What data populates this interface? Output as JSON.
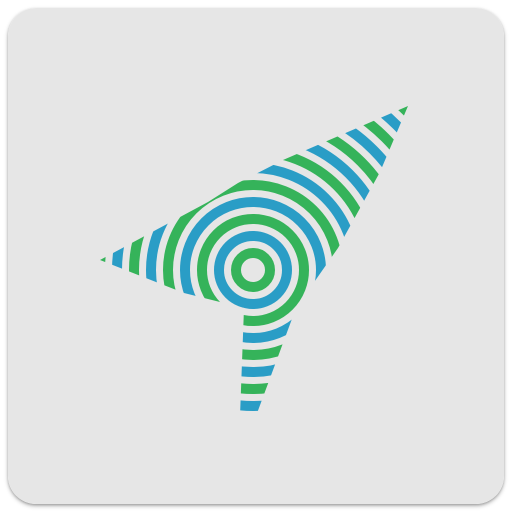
{
  "icon": {
    "name": "compass-arrow-icon",
    "colors": {
      "background": "#e6e6e6",
      "blue": "#2a9dc6",
      "green": "#35b35a"
    }
  }
}
